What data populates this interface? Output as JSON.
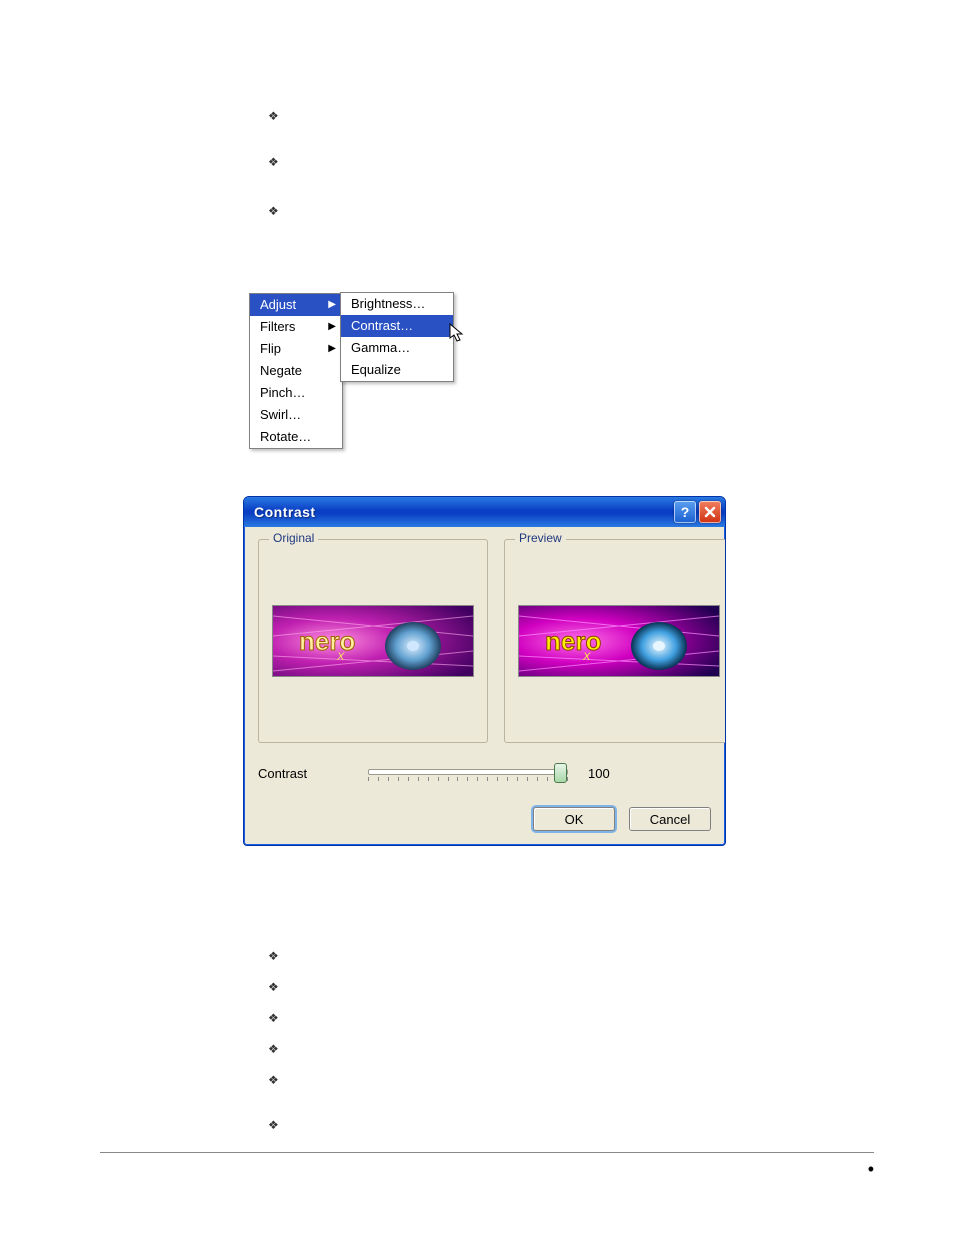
{
  "bullets_top": [
    "",
    "",
    ""
  ],
  "context_menu": {
    "main": [
      {
        "label": "Adjust",
        "has_submenu": true,
        "highlighted": true
      },
      {
        "label": "Filters",
        "has_submenu": true,
        "highlighted": false
      },
      {
        "label": "Flip",
        "has_submenu": true,
        "highlighted": false
      },
      {
        "label": "Negate",
        "has_submenu": false,
        "highlighted": false
      },
      {
        "label": "Pinch…",
        "has_submenu": false,
        "highlighted": false
      },
      {
        "label": "Swirl…",
        "has_submenu": false,
        "highlighted": false
      },
      {
        "label": "Rotate…",
        "has_submenu": false,
        "highlighted": false
      }
    ],
    "sub": [
      {
        "label": "Brightness…",
        "highlighted": false
      },
      {
        "label": "Contrast…",
        "highlighted": true
      },
      {
        "label": "Gamma…",
        "highlighted": false
      },
      {
        "label": "Equalize",
        "highlighted": false
      }
    ]
  },
  "dialog": {
    "title": "Contrast",
    "groups": {
      "original": "Original",
      "preview": "Preview"
    },
    "slider": {
      "label": "Contrast",
      "value": 100,
      "min": 0,
      "max": 100
    },
    "buttons": {
      "ok": "OK",
      "cancel": "Cancel"
    }
  },
  "bullets_bottom": [
    "",
    "",
    "",
    "",
    "",
    ""
  ],
  "colors": {
    "menu_highlight": "#2951c4",
    "title_gradient_top": "#2a7ae2",
    "title_gradient_mid": "#0a3fc4",
    "dialog_bg": "#ece9d8",
    "legend_text": "#203880"
  }
}
